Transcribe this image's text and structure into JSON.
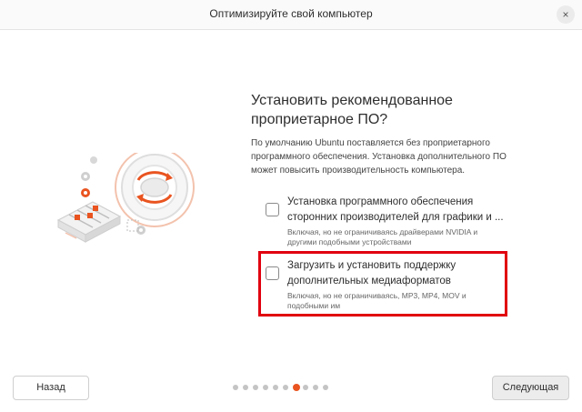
{
  "window": {
    "title": "Оптимизируйте свой компьютер",
    "close_symbol": "×"
  },
  "main": {
    "heading_line1": "Установить рекомендованное",
    "heading_line2": "проприетарное ПО?",
    "description": "По умолчанию Ubuntu поставляется без проприетарного программного обеспечения. Установка дополнительного ПО может повысить производительность компьютера."
  },
  "options": [
    {
      "title_line1": "Установка программного обеспечения",
      "title_line2": "сторонних производителей для графики и ...",
      "subtitle_line1": "Включая, но не ограничиваясь драйверами NVIDIA и",
      "subtitle_line2": "другими подобными устройствами",
      "checked": false
    },
    {
      "title_line1": "Загрузить и установить поддержку",
      "title_line2": "дополнительных медиаформатов",
      "subtitle_line1": "Включая, но не ограничиваясь, MP3, MP4, MOV и",
      "subtitle_line2": "подобными им",
      "checked": false
    }
  ],
  "footer": {
    "back_label": "Назад",
    "next_label": "Следующая",
    "page_count": 10,
    "current_page": 7
  },
  "colors": {
    "accent": "#e95420",
    "highlight_border": "#e1000f"
  },
  "icons": [
    "close-icon",
    "gear-icon",
    "settings-panel-icon",
    "refresh-arrows-icon"
  ]
}
